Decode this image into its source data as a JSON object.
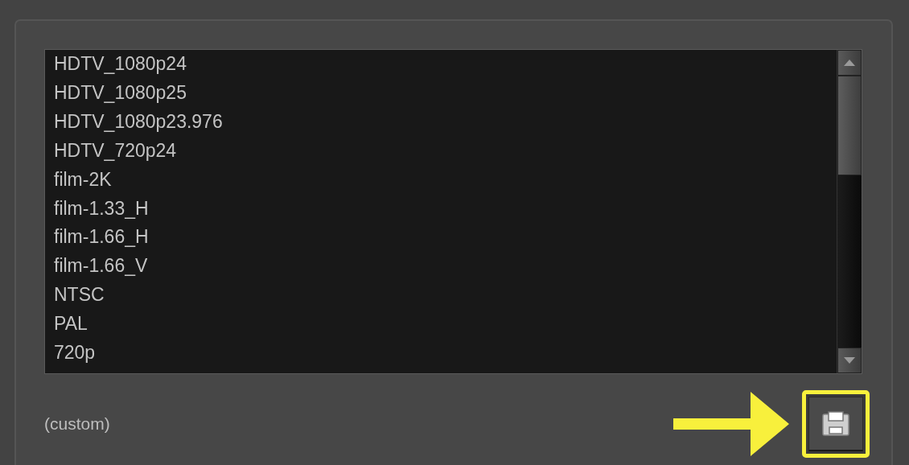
{
  "list": {
    "items": [
      {
        "label": "HDTV_1080p24",
        "selected": false
      },
      {
        "label": "HDTV_1080p25",
        "selected": false
      },
      {
        "label": "HDTV_1080p23.976",
        "selected": false
      },
      {
        "label": "HDTV_720p24",
        "selected": false
      },
      {
        "label": "film-2K",
        "selected": false
      },
      {
        "label": "film-1.33_H",
        "selected": false
      },
      {
        "label": "film-1.66_H",
        "selected": false
      },
      {
        "label": "film-1.66_V",
        "selected": false
      },
      {
        "label": "NTSC",
        "selected": false
      },
      {
        "label": "PAL",
        "selected": false
      },
      {
        "label": "720p",
        "selected": false
      }
    ]
  },
  "current": "(custom)"
}
